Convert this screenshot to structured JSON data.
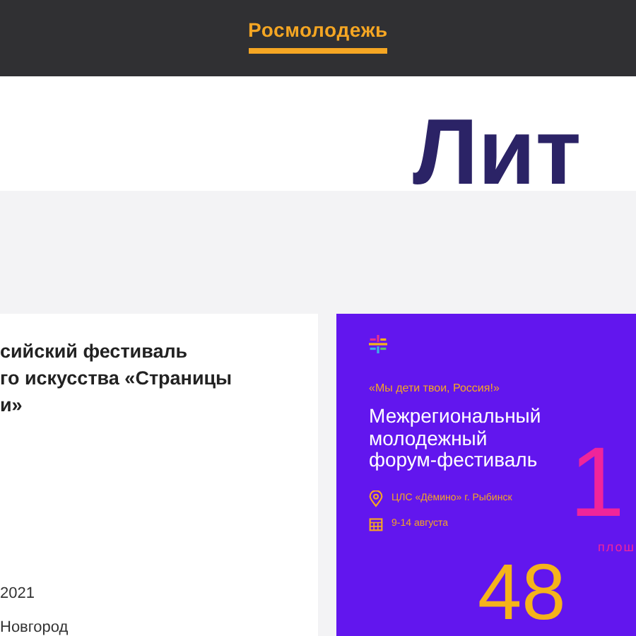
{
  "header": {
    "brand": "Росмолодежь",
    "selected": true
  },
  "hero": {
    "lines": [
      "Лит"
    ]
  },
  "event_card": {
    "title_lines": [
      "сийский фестиваль",
      "го искусства «Страницы",
      "и»"
    ],
    "date": "2021",
    "city": "Новгород"
  },
  "poster": {
    "tagline": "«Мы дети твои, Россия!»",
    "title_lines": [
      "Межрегиональный",
      "молодежный",
      "форум-фестиваль"
    ],
    "place": "ЦЛС «Дёмино» г. Рыбинск",
    "dates": "9-14 августа",
    "big_number": "1",
    "big_label": "плош",
    "count": "48"
  }
}
